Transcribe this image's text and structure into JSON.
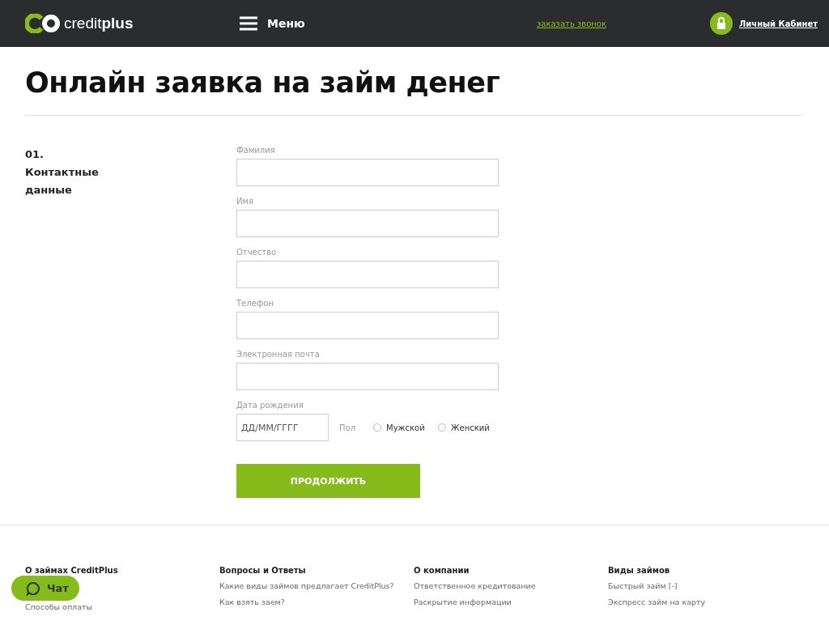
{
  "header": {
    "logo": {
      "part_1": "credit",
      "part_2": "plus"
    },
    "menu": "Меню",
    "callback_link": "заказать звонок",
    "account_link": "Личный Кабинет"
  },
  "title": "Онлайн заявка на займ денег",
  "section": {
    "number": "01.",
    "title": "Контактные данные"
  },
  "fields": [
    {
      "label": "Фамилия"
    },
    {
      "label": "Имя"
    },
    {
      "label": "Отчество"
    },
    {
      "label": "Телефон"
    },
    {
      "label": "Электронная почта"
    }
  ],
  "birth": {
    "label": "Дата рождения",
    "placeholder": "ДД/ММ/ГГГГ"
  },
  "gender": {
    "label": "Пол",
    "options": [
      {
        "label": "Мужской",
        "selected": false
      },
      {
        "label": "Женский",
        "selected": false
      }
    ]
  },
  "submit": "ПРОДОЛЖИТЬ",
  "footer": [
    {
      "heading": "О займах CreditPlus",
      "links": [
        "Способы оплаты"
      ]
    },
    {
      "heading": "Вопросы и Ответы",
      "links": [
        "Какие виды займов предлагает CreditPlus?",
        "Как взять заем?"
      ]
    },
    {
      "heading": "О компании",
      "links": [
        "Ответственное кредитование",
        "Раскрытие информации"
      ]
    },
    {
      "heading": "Виды займов",
      "links": [
        "Быстрый займ [-]",
        "Экспресс займ на карту"
      ]
    }
  ],
  "chat": "Чат"
}
